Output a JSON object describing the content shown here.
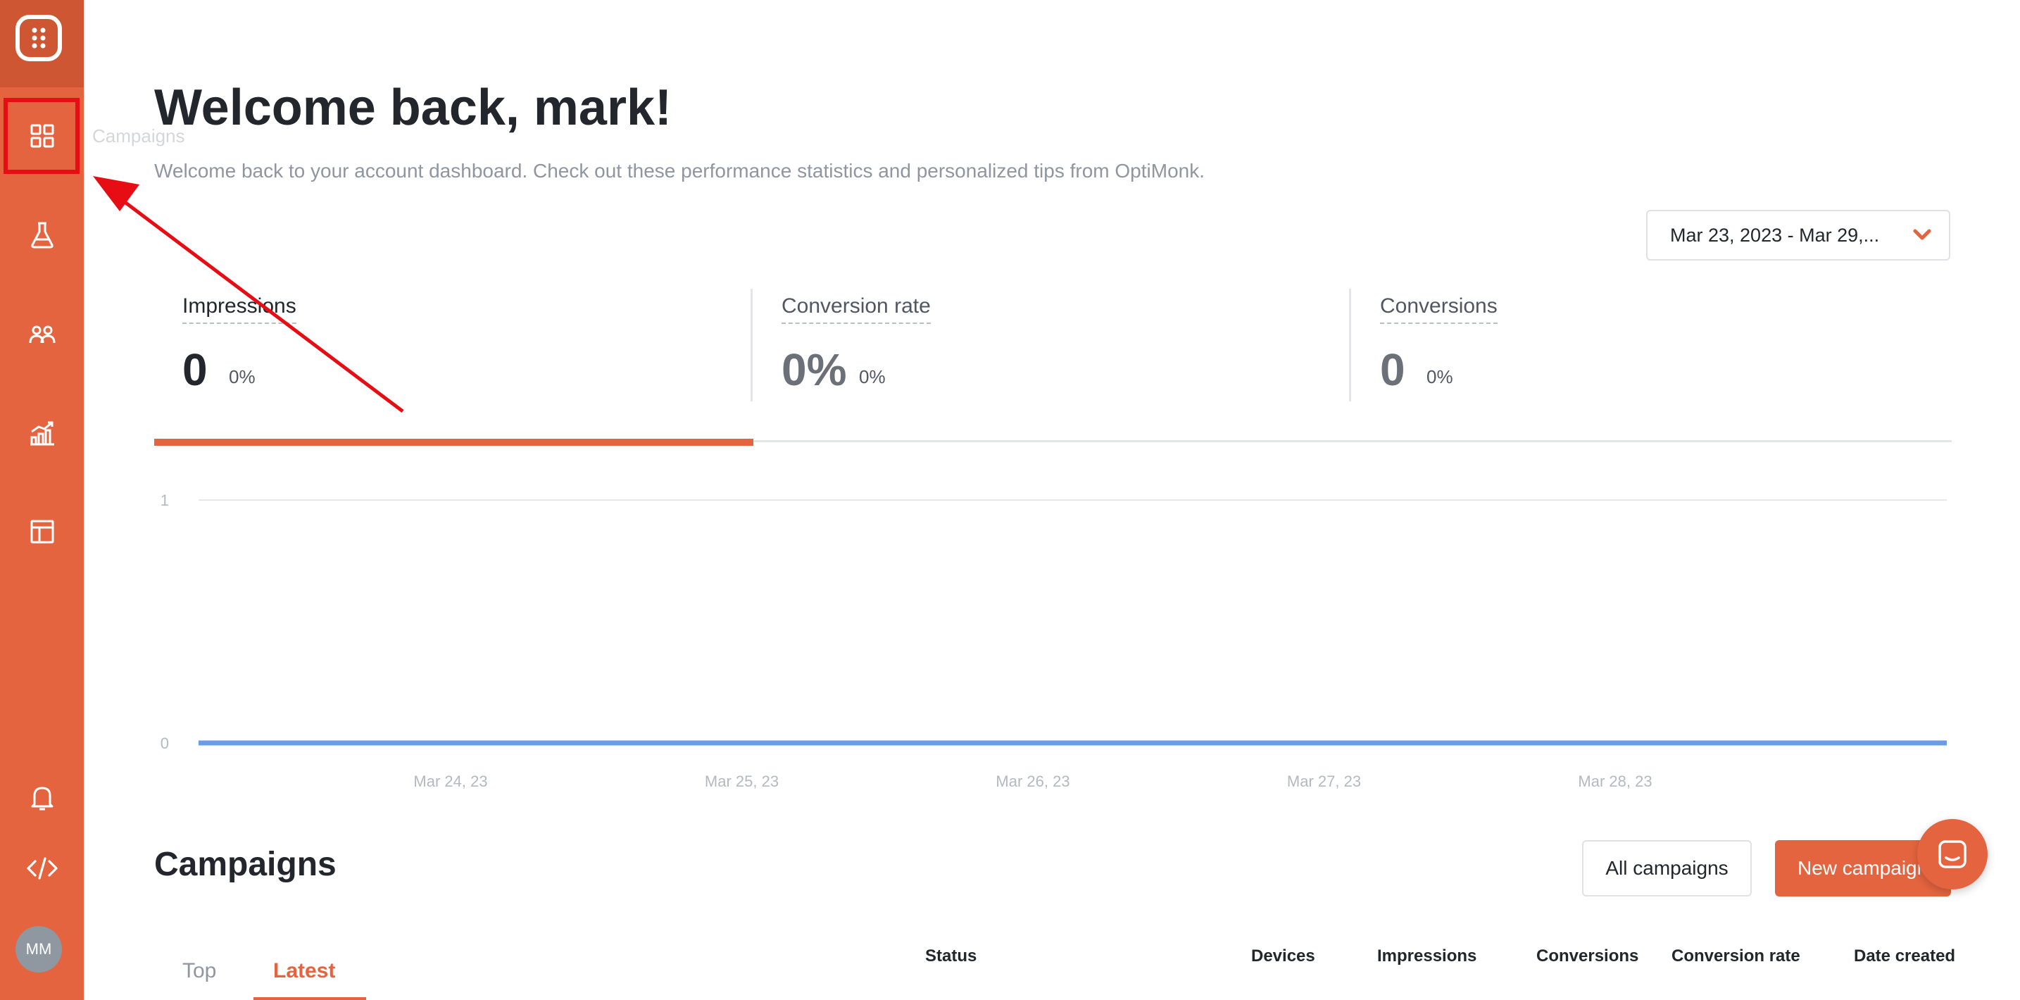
{
  "sidebar": {
    "logo_icon": "dice-logo-icon",
    "items": [
      {
        "icon": "grid-icon",
        "label": "Campaigns"
      },
      {
        "icon": "flask-icon"
      },
      {
        "icon": "users-icon"
      },
      {
        "icon": "analytics-icon"
      },
      {
        "icon": "layout-icon"
      }
    ],
    "bottom": [
      {
        "icon": "bell-icon"
      },
      {
        "icon": "code-icon"
      }
    ],
    "avatar_initials": "MM",
    "tooltip": "Campaigns"
  },
  "header": {
    "title": "Welcome back, mark!",
    "subtitle": "Welcome back to your account dashboard. Check out these performance statistics and personalized tips from OptiMonk."
  },
  "date_range": {
    "value": "Mar 23, 2023 - Mar 29,...",
    "icon": "chevron-down-icon"
  },
  "kpis": [
    {
      "label": "Impressions",
      "value": "0",
      "change": "0%",
      "active": true
    },
    {
      "label": "Conversion rate",
      "value": "0%",
      "change": "0%",
      "active": false
    },
    {
      "label": "Conversions",
      "value": "0",
      "change": "0%",
      "active": false
    }
  ],
  "chart_data": {
    "type": "line",
    "x": [
      "Mar 24, 23",
      "Mar 25, 23",
      "Mar 26, 23",
      "Mar 27, 23",
      "Mar 28, 23"
    ],
    "series": [
      {
        "values": [
          0,
          0,
          0,
          0,
          0
        ]
      }
    ],
    "ylim": [
      0,
      1
    ],
    "yticks": [
      "1",
      "0"
    ],
    "xlabel": "",
    "ylabel": "",
    "grid": true,
    "colors": {
      "line": "#6a9be8",
      "grid": "#e6e8eb"
    }
  },
  "campaigns": {
    "title": "Campaigns",
    "all_button": "All campaigns",
    "new_button": "New campaign",
    "tabs": [
      {
        "label": "Top",
        "active": false
      },
      {
        "label": "Latest",
        "active": true
      }
    ],
    "columns": [
      "Status",
      "Devices",
      "Impressions",
      "Conversions",
      "Conversion rate",
      "Date created"
    ]
  },
  "colors": {
    "brand": "#e4643f",
    "highlight": "#e60d14"
  }
}
